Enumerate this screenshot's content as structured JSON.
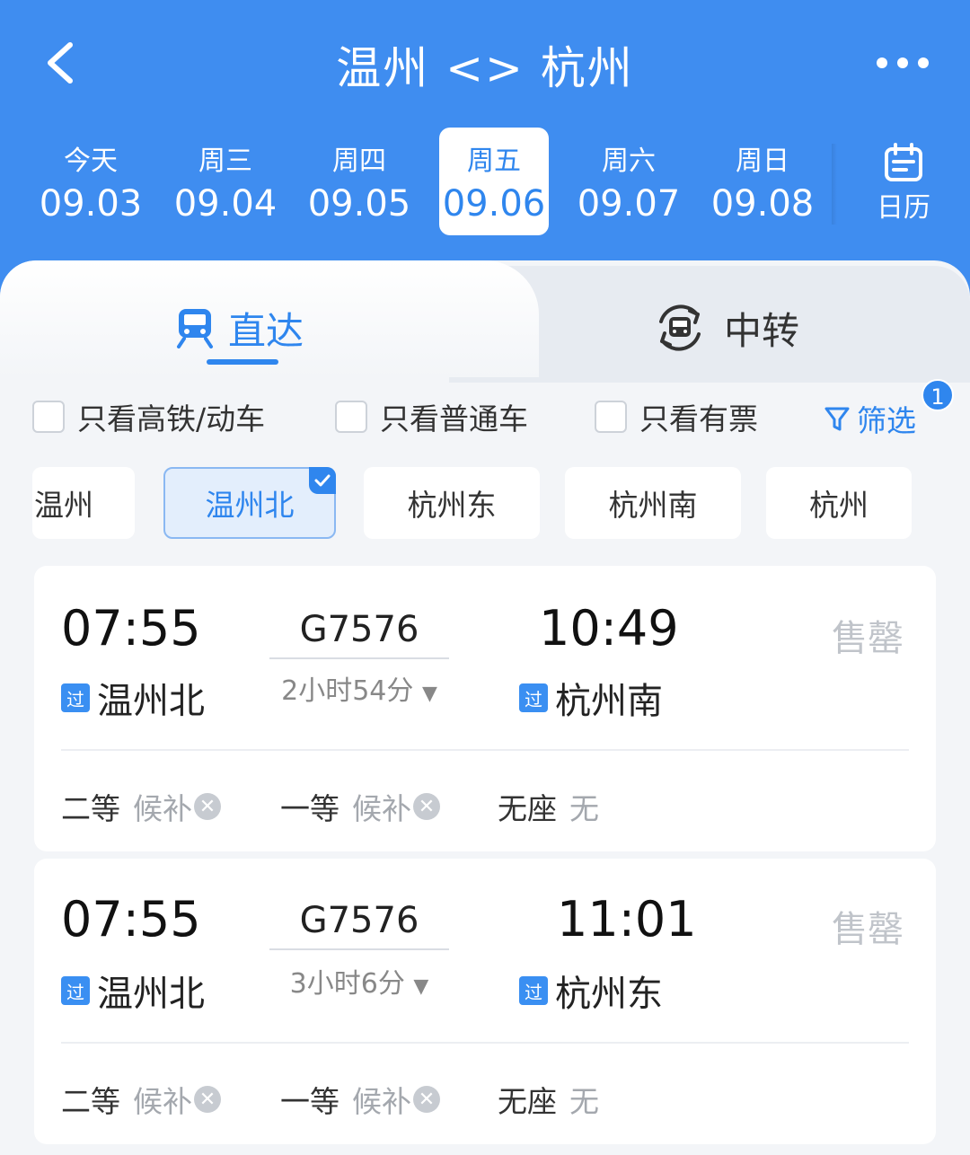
{
  "header": {
    "title": "温州 <> 杭州",
    "back_icon": "chevron-left-icon",
    "more_icon": "more-dots-icon"
  },
  "dates": [
    {
      "weekday": "今天",
      "date": "09.03",
      "selected": false
    },
    {
      "weekday": "周三",
      "date": "09.04",
      "selected": false
    },
    {
      "weekday": "周四",
      "date": "09.05",
      "selected": false
    },
    {
      "weekday": "周五",
      "date": "09.06",
      "selected": true
    },
    {
      "weekday": "周六",
      "date": "09.07",
      "selected": false
    },
    {
      "weekday": "周日",
      "date": "09.08",
      "selected": false
    }
  ],
  "calendar": {
    "label": "日历",
    "icon": "calendar-icon"
  },
  "tabs": {
    "direct": {
      "label": "直达",
      "icon": "train-icon",
      "active": true
    },
    "transfer": {
      "label": "中转",
      "icon": "transfer-train-icon",
      "active": false
    }
  },
  "filters": {
    "high_speed_only": {
      "label": "只看高铁/动车",
      "checked": false
    },
    "regular_only": {
      "label": "只看普通车",
      "checked": false
    },
    "available_only": {
      "label": "只看有票",
      "checked": false
    },
    "filter_button": {
      "label": "筛选",
      "icon": "funnel-icon",
      "badge": "1"
    }
  },
  "stations": [
    {
      "name": "温州",
      "selected": false
    },
    {
      "name": "温州北",
      "selected": true
    },
    {
      "name": "杭州东",
      "selected": false
    },
    {
      "name": "杭州南",
      "selected": false
    },
    {
      "name": "杭州",
      "selected": false
    }
  ],
  "trains": [
    {
      "depart_time": "07:55",
      "depart_station": "温州北",
      "train_no": "G7576",
      "duration": "2小时54分",
      "arrive_time": "10:49",
      "arrive_station": "杭州南",
      "pass_tag": "过",
      "status": "售罄",
      "seats": [
        {
          "class": "二等",
          "status": "候补"
        },
        {
          "class": "一等",
          "status": "候补"
        },
        {
          "class": "无座",
          "status": "无"
        }
      ]
    },
    {
      "depart_time": "07:55",
      "depart_station": "温州北",
      "train_no": "G7576",
      "duration": "3小时6分",
      "arrive_time": "11:01",
      "arrive_station": "杭州东",
      "pass_tag": "过",
      "status": "售罄",
      "seats": [
        {
          "class": "二等",
          "status": "候补"
        },
        {
          "class": "一等",
          "status": "候补"
        },
        {
          "class": "无座",
          "status": "无"
        }
      ]
    }
  ],
  "colors": {
    "brand_blue": "#3f8df0",
    "accent_blue": "#2f86ee",
    "sold_out_gray": "#c0c4ca"
  }
}
